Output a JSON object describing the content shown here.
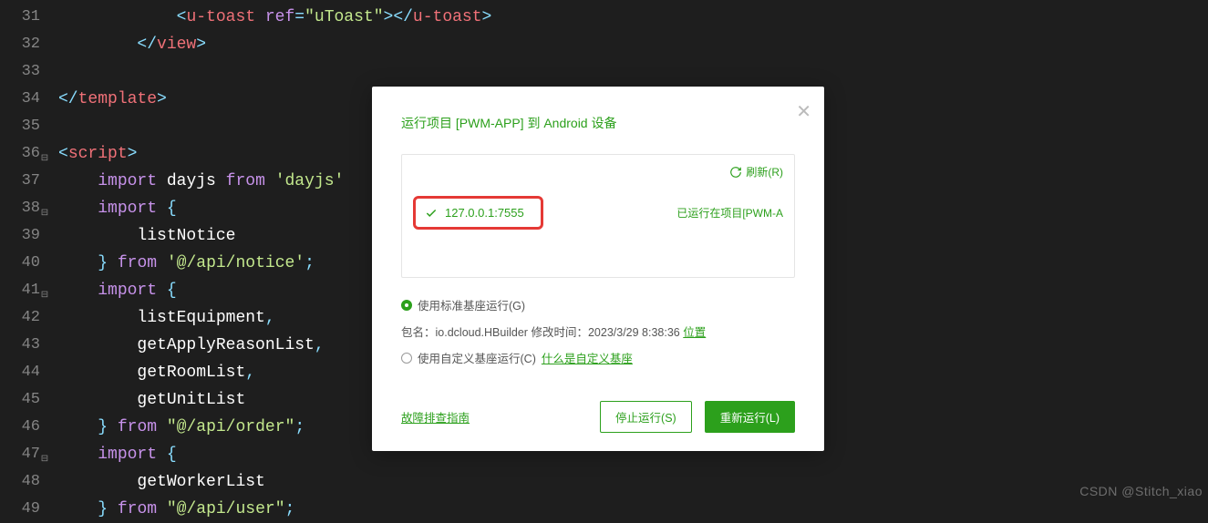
{
  "editor": {
    "lines": [
      {
        "n": 31,
        "fold": false
      },
      {
        "n": 32,
        "fold": false
      },
      {
        "n": 33,
        "fold": false
      },
      {
        "n": 34,
        "fold": false
      },
      {
        "n": 35,
        "fold": false
      },
      {
        "n": 36,
        "fold": true
      },
      {
        "n": 37,
        "fold": false
      },
      {
        "n": 38,
        "fold": true
      },
      {
        "n": 39,
        "fold": false
      },
      {
        "n": 40,
        "fold": false
      },
      {
        "n": 41,
        "fold": true
      },
      {
        "n": 42,
        "fold": false
      },
      {
        "n": 43,
        "fold": false
      },
      {
        "n": 44,
        "fold": false
      },
      {
        "n": 45,
        "fold": false
      },
      {
        "n": 46,
        "fold": false
      },
      {
        "n": 47,
        "fold": true
      },
      {
        "n": 48,
        "fold": false
      },
      {
        "n": 49,
        "fold": false
      }
    ],
    "code_tokens": {
      "l31": "            <u-toast ref=\"uToast\"></u-toast>",
      "l32": "        </view>",
      "l33": "",
      "l34": "</template>",
      "l35": "",
      "l36": "<script>",
      "l37": "    import dayjs from 'dayjs'",
      "l38": "    import {",
      "l39": "        listNotice",
      "l40": "    } from '@/api/notice';",
      "l41": "    import {",
      "l42": "        listEquipment,",
      "l43": "        getApplyReasonList,",
      "l44": "        getRoomList,",
      "l45": "        getUnitList",
      "l46": "    } from \"@/api/order\";",
      "l47": "    import {",
      "l48": "        getWorkerList",
      "l49": "    } from \"@/api/user\";"
    }
  },
  "dialog": {
    "title": "运行项目 [PWM-APP] 到 Android 设备",
    "refresh_label": "刷新(R)",
    "device_ip": "127.0.0.1:7555",
    "device_status": "已运行在项目[PWM-A",
    "opt_standard": "使用标准基座运行(G)",
    "pkg_label": "包名：",
    "pkg_name": "io.dcloud.HBuilder",
    "mod_label": "修改时间：",
    "mod_time": "2023/3/29 8:38:36",
    "location_link": "位置",
    "opt_custom": "使用自定义基座运行(C)",
    "what_is_custom": "什么是自定义基座",
    "guide_link": "故障排查指南",
    "stop_btn": "停止运行(S)",
    "rerun_btn": "重新运行(L)"
  },
  "watermark": "CSDN @Stitch_xiao"
}
